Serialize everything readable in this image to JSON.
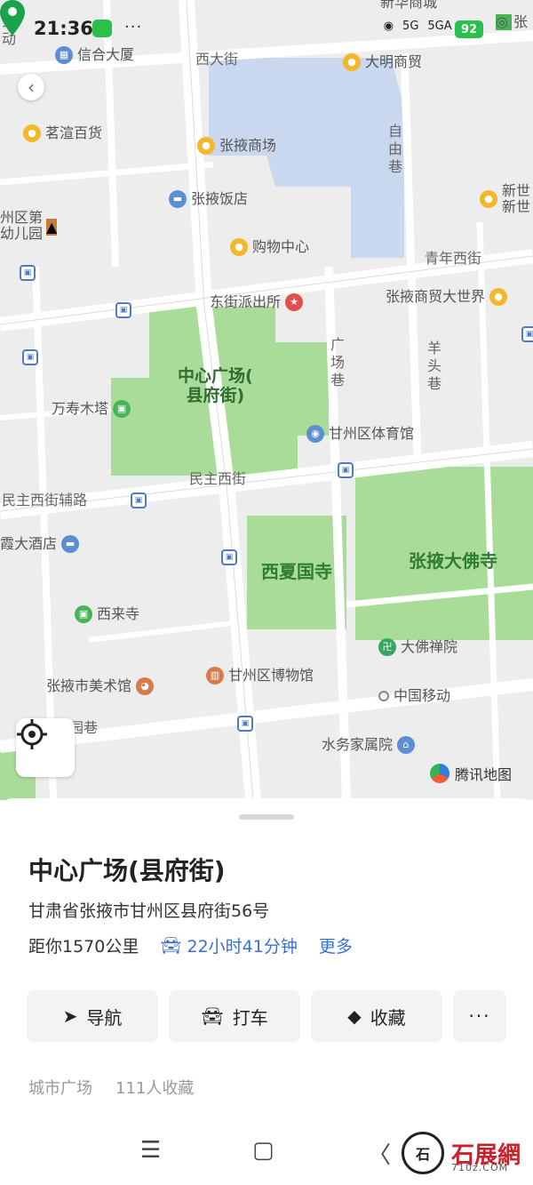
{
  "status_bar": {
    "time": "21:36",
    "dots": "···",
    "net1": "5G",
    "net2": "5GA",
    "battery": "92"
  },
  "map": {
    "roads": {
      "xidajie": "西大街",
      "ziyouxiang": "自\n由\n巷",
      "qingnianxijie": "青年西街",
      "guangchangxiang": "广\n场\n巷",
      "yangtouxiang": "羊\n头\n巷",
      "minzhuxijie": "民主西街",
      "minzhuxijiefu": "民主西街辅路",
      "yuanxiang": "园巷",
      "laodong": "劳\n动"
    },
    "pois": {
      "xinhe": "信合大厦",
      "daming": "大明商贸",
      "xinhua": "新华商城",
      "minxuan": "茗渲百货",
      "zhangye_mall": "张掖商场",
      "zhangye_hotel": "张掖饭店",
      "ganzhou_kg": "州区第\n幼儿园",
      "xinshiji": "新世\n新世",
      "shopping": "购物中心",
      "police": "东街派出所",
      "shangmao": "张掖商贸大世界",
      "center": "中心广场(\n县府街)",
      "wanshou": "万寿木塔",
      "stadium": "甘州区体育馆",
      "xia_hotel": "霞大酒店",
      "xixia": "西夏国寺",
      "dafosi": "张掖大佛寺",
      "xilai": "西来寺",
      "chanyuan": "大佛禅院",
      "meishuguan": "张掖市美术馆",
      "museum": "甘州区博物馆",
      "mobile": "中国移动",
      "shuiwu": "水务家属院",
      "top_right": "张"
    },
    "provider": "腾讯地图"
  },
  "place": {
    "title": "中心广场(县府街)",
    "address": "甘肃省张掖市甘州区县府街56号",
    "distance": "距你1570公里",
    "drive_time": "22小时41分钟",
    "more": "更多",
    "category": "城市广场",
    "favorites": "111人收藏"
  },
  "actions": {
    "navigate": "导航",
    "taxi": "打车",
    "favorite": "收藏",
    "more": "···"
  },
  "nav_bar": {
    "menu": "☰",
    "home": "▢",
    "back": "〈"
  },
  "watermark": {
    "name": "石展網",
    "url": "710z.COM",
    "seal": "石"
  },
  "colors": {
    "green": "#49b35a",
    "accent": "#3b6fcf",
    "park": "#a9dc98"
  }
}
